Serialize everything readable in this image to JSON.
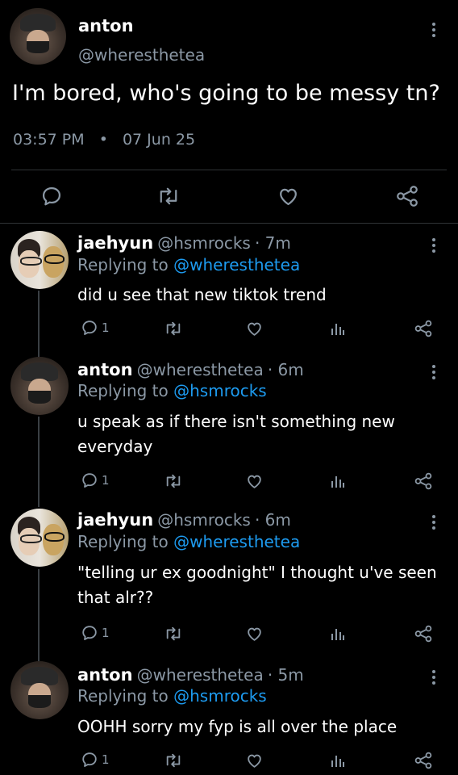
{
  "main_tweet": {
    "name": "anton",
    "handle": "@wheresthetea",
    "text": "I'm bored, who's going to be messy tn?",
    "time": "03:57 PM",
    "separator": "•",
    "date": "07 Jun 25"
  },
  "replies": [
    {
      "name": "jaehyun",
      "handle": "@hsmrocks",
      "age": "· 7m",
      "replying_prefix": "Replying to ",
      "replying_to": "@wheresthetea",
      "text": "did u see that new tiktok trend",
      "reply_count": "1"
    },
    {
      "name": "anton",
      "handle": "@wheresthetea",
      "age": "· 6m",
      "replying_prefix": "Replying to ",
      "replying_to": "@hsmrocks",
      "text": "u speak as if there isn't something new everyday",
      "reply_count": "1"
    },
    {
      "name": "jaehyun",
      "handle": "@hsmrocks",
      "age": "· 6m",
      "replying_prefix": "Replying to ",
      "replying_to": "@wheresthetea",
      "text": "\"telling ur ex goodnight\" I thought u've seen that alr??",
      "reply_count": "1"
    },
    {
      "name": "anton",
      "handle": "@wheresthetea",
      "age": "· 5m",
      "replying_prefix": "Replying to ",
      "replying_to": "@hsmrocks",
      "text": "OOHH sorry my fyp is all over the place",
      "reply_count": "1"
    }
  ],
  "colors": {
    "background": "#000000",
    "text": "#ffffff",
    "secondary": "#8b98a5",
    "link": "#1d9bf0",
    "divider": "#2f3336"
  },
  "icons": [
    "more-dots-icon",
    "reply-icon",
    "retweet-icon",
    "like-icon",
    "share-icon",
    "analytics-icon"
  ]
}
